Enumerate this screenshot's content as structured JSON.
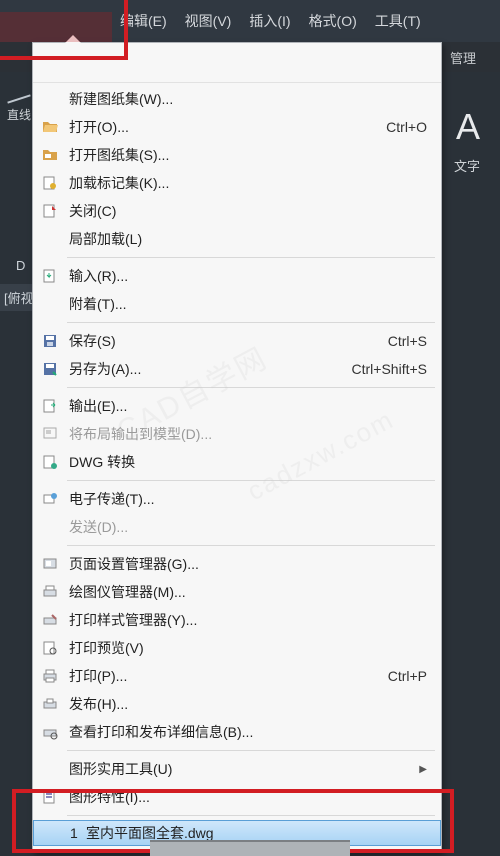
{
  "menubar": {
    "items": [
      {
        "label": "编辑(E)"
      },
      {
        "label": "视图(V)"
      },
      {
        "label": "插入(I)"
      },
      {
        "label": "格式(O)"
      },
      {
        "label": "工具(T)"
      }
    ],
    "ribbon_right": "管理"
  },
  "left": {
    "line_label": "直线",
    "d_label": "D",
    "view_label": "[俯视"
  },
  "annot": {
    "A": "A",
    "text": "文字"
  },
  "menu": [
    {
      "icon": null,
      "label": "新建图纸集(W)...",
      "shortcut": "",
      "sub": false,
      "sep_after": false
    },
    {
      "icon": "open",
      "label": "打开(O)...",
      "shortcut": "Ctrl+O",
      "sub": false,
      "sep_after": false
    },
    {
      "icon": "open-sheet",
      "label": "打开图纸集(S)...",
      "shortcut": "",
      "sub": false,
      "sep_after": false
    },
    {
      "icon": "marker",
      "label": "加载标记集(K)...",
      "shortcut": "",
      "sub": false,
      "sep_after": false
    },
    {
      "icon": "close",
      "label": "关闭(C)",
      "shortcut": "",
      "sub": false,
      "sep_after": false
    },
    {
      "icon": null,
      "label": "局部加载(L)",
      "shortcut": "",
      "sub": false,
      "sep_after": true
    },
    {
      "icon": "import",
      "label": "输入(R)...",
      "shortcut": "",
      "sub": false,
      "sep_after": false
    },
    {
      "icon": null,
      "label": "附着(T)...",
      "shortcut": "",
      "sub": false,
      "sep_after": true
    },
    {
      "icon": "save",
      "label": "保存(S)",
      "shortcut": "Ctrl+S",
      "sub": false,
      "sep_after": false
    },
    {
      "icon": "saveas",
      "label": "另存为(A)...",
      "shortcut": "Ctrl+Shift+S",
      "sub": false,
      "sep_after": true
    },
    {
      "icon": "export",
      "label": "输出(E)...",
      "shortcut": "",
      "sub": false,
      "sep_after": false
    },
    {
      "icon": "layout",
      "label": "将布局输出到模型(D)...",
      "shortcut": "",
      "sub": false,
      "disabled": true,
      "sep_after": false
    },
    {
      "icon": "dwg",
      "label": "DWG 转换",
      "shortcut": "",
      "sub": false,
      "sep_after": true
    },
    {
      "icon": "etransmit",
      "label": "电子传递(T)...",
      "shortcut": "",
      "sub": false,
      "sep_after": false
    },
    {
      "icon": null,
      "label": "发送(D)...",
      "shortcut": "",
      "sub": false,
      "disabled": true,
      "sep_after": true
    },
    {
      "icon": "page-setup",
      "label": "页面设置管理器(G)...",
      "shortcut": "",
      "sub": false,
      "sep_after": false
    },
    {
      "icon": "plotter",
      "label": "绘图仪管理器(M)...",
      "shortcut": "",
      "sub": false,
      "sep_after": false
    },
    {
      "icon": "plotstyle",
      "label": "打印样式管理器(Y)...",
      "shortcut": "",
      "sub": false,
      "sep_after": false
    },
    {
      "icon": "preview",
      "label": "打印预览(V)",
      "shortcut": "",
      "sub": false,
      "sep_after": false
    },
    {
      "icon": "print",
      "label": "打印(P)...",
      "shortcut": "Ctrl+P",
      "sub": false,
      "sep_after": false
    },
    {
      "icon": "publish",
      "label": "发布(H)...",
      "shortcut": "",
      "sub": false,
      "sep_after": false
    },
    {
      "icon": "details",
      "label": "查看打印和发布详细信息(B)...",
      "shortcut": "",
      "sub": false,
      "sep_after": true
    },
    {
      "icon": null,
      "label": "图形实用工具(U)",
      "shortcut": "",
      "sub": true,
      "sep_after": false
    },
    {
      "icon": "props",
      "label": "图形特性(I)...",
      "shortcut": "",
      "sub": false,
      "sep_after": true
    }
  ],
  "recent": {
    "num": "1",
    "name": "室内平面图全套.dwg"
  },
  "watermarks": [
    "CAD自学网",
    "cadzxw.com"
  ],
  "colors": {
    "highlight_border": "#d21d23"
  }
}
